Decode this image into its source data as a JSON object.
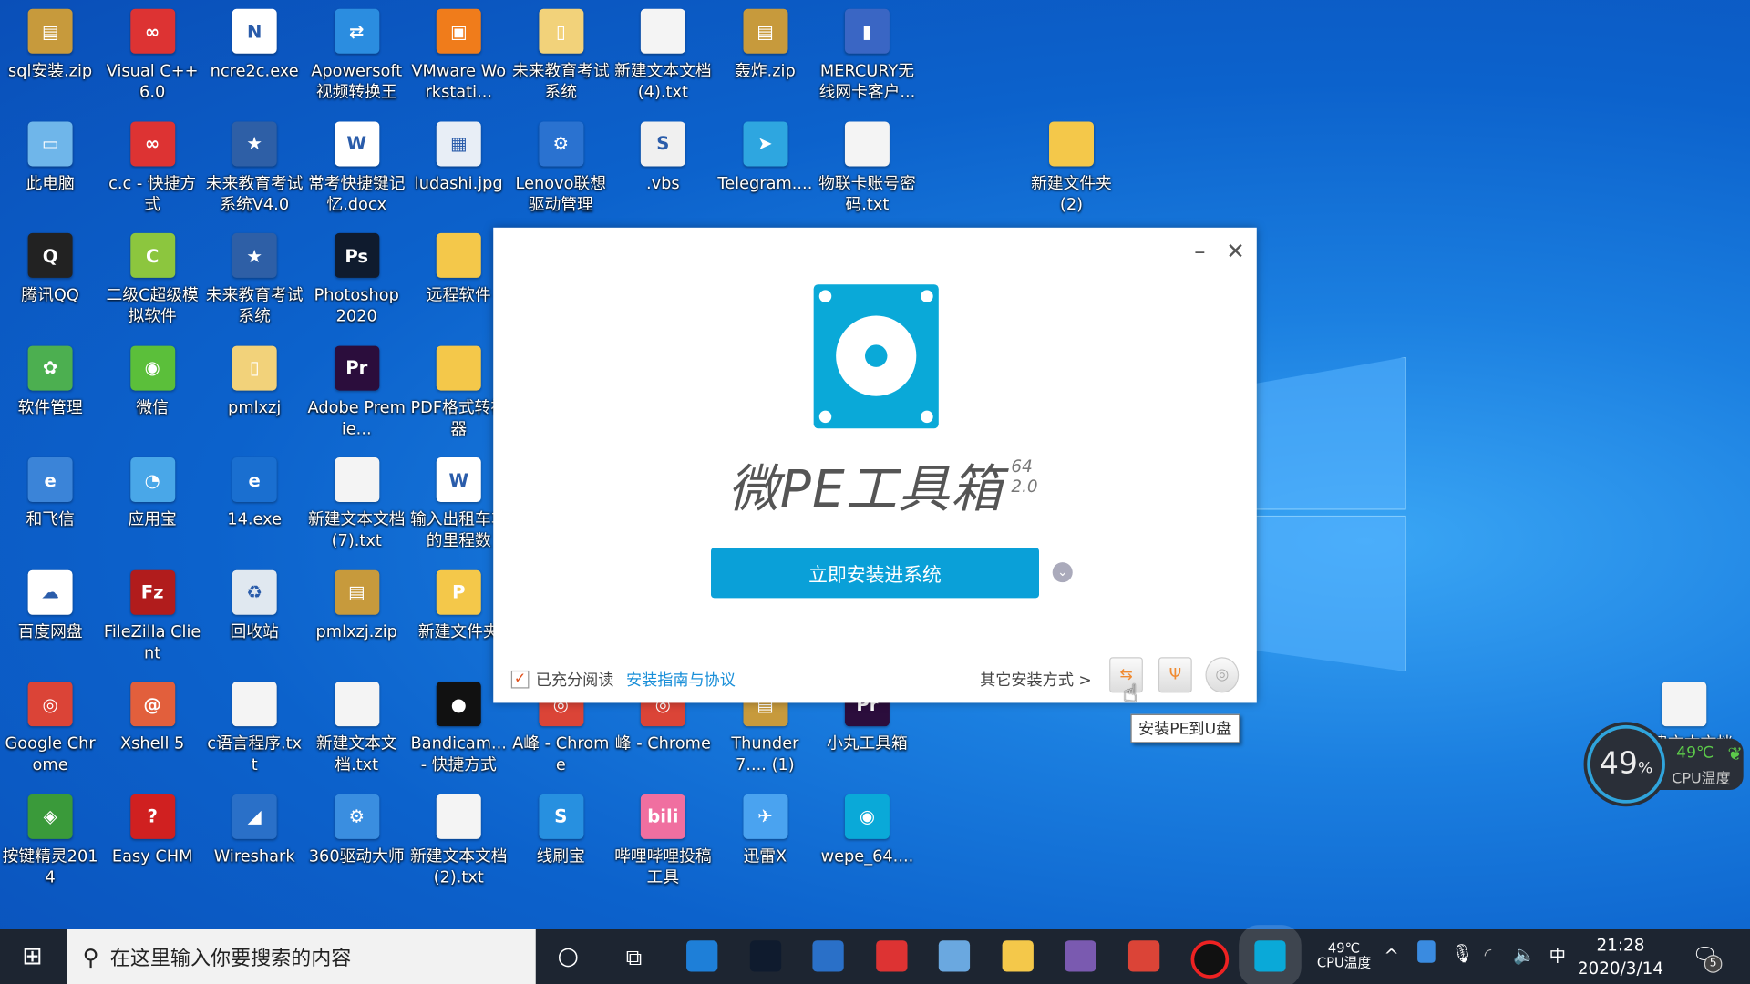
{
  "desktop": {
    "icons": [
      {
        "label": "sql安装.zip",
        "kind": "zip",
        "col": 0,
        "row": 0
      },
      {
        "label": "Visual C++ 6.0",
        "kind": "vc",
        "col": 1,
        "row": 0
      },
      {
        "label": "ncre2c.exe",
        "kind": "ncre",
        "col": 2,
        "row": 0
      },
      {
        "label": "Apowersoft视频转换王",
        "kind": "apower",
        "col": 3,
        "row": 0
      },
      {
        "label": "VMware Workstati...",
        "kind": "vmware",
        "col": 4,
        "row": 0
      },
      {
        "label": "未来教育考试系统",
        "kind": "folderdoc",
        "col": 5,
        "row": 0
      },
      {
        "label": "新建文本文档(4).txt",
        "kind": "txt",
        "col": 6,
        "row": 0
      },
      {
        "label": "轰炸.zip",
        "kind": "zip",
        "col": 7,
        "row": 0
      },
      {
        "label": "MERCURY无线网卡客户...",
        "kind": "mercury",
        "col": 8,
        "row": 0
      },
      {
        "label": "此电脑",
        "kind": "pc",
        "col": 0,
        "row": 1
      },
      {
        "label": "c.c - 快捷方式",
        "kind": "vc",
        "col": 1,
        "row": 1
      },
      {
        "label": "未来教育考试系统V4.0",
        "kind": "exam",
        "col": 2,
        "row": 1
      },
      {
        "label": "常考快捷键记忆.docx",
        "kind": "word",
        "col": 3,
        "row": 1
      },
      {
        "label": "ludashi.jpg",
        "kind": "jpg",
        "col": 4,
        "row": 1
      },
      {
        "label": "Lenovo联想驱动管理",
        "kind": "lenovo",
        "col": 5,
        "row": 1
      },
      {
        "label": ".vbs",
        "kind": "vbs",
        "col": 6,
        "row": 1
      },
      {
        "label": "Telegram....",
        "kind": "telegram",
        "col": 7,
        "row": 1
      },
      {
        "label": "物联卡账号密码.txt",
        "kind": "txt",
        "col": 8,
        "row": 1
      },
      {
        "label": "新建文件夹 (2)",
        "kind": "folder",
        "col": 10,
        "row": 1
      },
      {
        "label": "腾讯QQ",
        "kind": "qq",
        "col": 0,
        "row": 2
      },
      {
        "label": "二级C超级模拟软件",
        "kind": "c2",
        "col": 1,
        "row": 2
      },
      {
        "label": "未来教育考试系统",
        "kind": "exam",
        "col": 2,
        "row": 2
      },
      {
        "label": "Photoshop 2020",
        "kind": "ps",
        "col": 3,
        "row": 2
      },
      {
        "label": "远程软件",
        "kind": "folder",
        "col": 4,
        "row": 2
      },
      {
        "label": "软件管理",
        "kind": "softmgr",
        "col": 0,
        "row": 3
      },
      {
        "label": "微信",
        "kind": "wechat",
        "col": 1,
        "row": 3
      },
      {
        "label": "pmlxzj",
        "kind": "folderdoc",
        "col": 2,
        "row": 3
      },
      {
        "label": "Adobe Premie...",
        "kind": "pr",
        "col": 3,
        "row": 3
      },
      {
        "label": "PDF格式转神器",
        "kind": "folder",
        "col": 4,
        "row": 3
      },
      {
        "label": "和飞信",
        "kind": "fetion",
        "col": 0,
        "row": 4
      },
      {
        "label": "应用宝",
        "kind": "yyb",
        "col": 1,
        "row": 4
      },
      {
        "label": "14.exe",
        "kind": "exe14",
        "col": 2,
        "row": 4
      },
      {
        "label": "新建文本文档(7).txt",
        "kind": "txt",
        "col": 3,
        "row": 4
      },
      {
        "label": "输入出租车车的里程数",
        "kind": "word",
        "col": 4,
        "row": 4
      },
      {
        "label": "百度网盘",
        "kind": "baidu",
        "col": 0,
        "row": 5
      },
      {
        "label": "FileZilla Client",
        "kind": "filezilla",
        "col": 1,
        "row": 5
      },
      {
        "label": "回收站",
        "kind": "recycle",
        "col": 2,
        "row": 5
      },
      {
        "label": "pmlxzj.zip",
        "kind": "zip",
        "col": 3,
        "row": 5
      },
      {
        "label": "新建文件夹",
        "kind": "folderpdf",
        "col": 4,
        "row": 5
      },
      {
        "label": "Google Chrome",
        "kind": "chrome",
        "col": 0,
        "row": 6
      },
      {
        "label": "Xshell 5",
        "kind": "xshell",
        "col": 1,
        "row": 6
      },
      {
        "label": "c语言程序.txt",
        "kind": "txt",
        "col": 2,
        "row": 6
      },
      {
        "label": "新建文本文档.txt",
        "kind": "txt",
        "col": 3,
        "row": 6
      },
      {
        "label": "Bandicam... - 快捷方式",
        "kind": "bandicam",
        "col": 4,
        "row": 6
      },
      {
        "label": "A峰 - Chrome",
        "kind": "chrome",
        "col": 5,
        "row": 6
      },
      {
        "label": "峰 - Chrome",
        "kind": "chrome",
        "col": 6,
        "row": 6
      },
      {
        "label": "Thunder7.... (1)",
        "kind": "zip",
        "col": 7,
        "row": 6
      },
      {
        "label": "小丸工具箱",
        "kind": "pr",
        "col": 8,
        "row": 6
      },
      {
        "label": "按键精灵2014",
        "kind": "ajjl",
        "col": 0,
        "row": 7
      },
      {
        "label": "Easy CHM",
        "kind": "chm",
        "col": 1,
        "row": 7
      },
      {
        "label": "Wireshark",
        "kind": "wireshark",
        "col": 2,
        "row": 7
      },
      {
        "label": "360驱动大师",
        "kind": "drv360",
        "col": 3,
        "row": 7
      },
      {
        "label": "新建文本文档(2).txt",
        "kind": "txt",
        "col": 4,
        "row": 7
      },
      {
        "label": "线刷宝",
        "kind": "xsb",
        "col": 5,
        "row": 7
      },
      {
        "label": "哔哩哔哩投稿工具",
        "kind": "bili",
        "col": 6,
        "row": 7
      },
      {
        "label": "迅雷X",
        "kind": "xunlei",
        "col": 7,
        "row": 7
      },
      {
        "label": "wepe_64....",
        "kind": "wepe",
        "col": 8,
        "row": 7
      },
      {
        "label": "新建文本文档",
        "kind": "txt",
        "col": 16,
        "row": 6
      }
    ]
  },
  "dialog": {
    "title": "微PE工具箱",
    "arch": "64",
    "version": "2.0",
    "install_button": "立即安装进系统",
    "agree_label": "已充分阅读",
    "agree_checked": true,
    "agreement_link": "安装指南与协议",
    "other_methods": "其它安装方式 >",
    "tooltip": "安装PE到U盘",
    "accent": "#0aa9d8"
  },
  "widget": {
    "cpu_percent": "49",
    "percent_sign": "%",
    "temp": "49℃",
    "label": "CPU温度"
  },
  "taskbar": {
    "search_placeholder": "在这里输入你要搜索的内容",
    "cpu_temp": "49℃",
    "cpu_label": "CPU温度",
    "ime": "中",
    "time": "21:28",
    "date": "2020/3/14",
    "notifications": "5",
    "apps": [
      "edge",
      "photoshop",
      "wireshark",
      "visual-cpp",
      "control-panel",
      "file-explorer",
      "winrar",
      "chrome",
      "bandicam",
      "wepe"
    ]
  }
}
